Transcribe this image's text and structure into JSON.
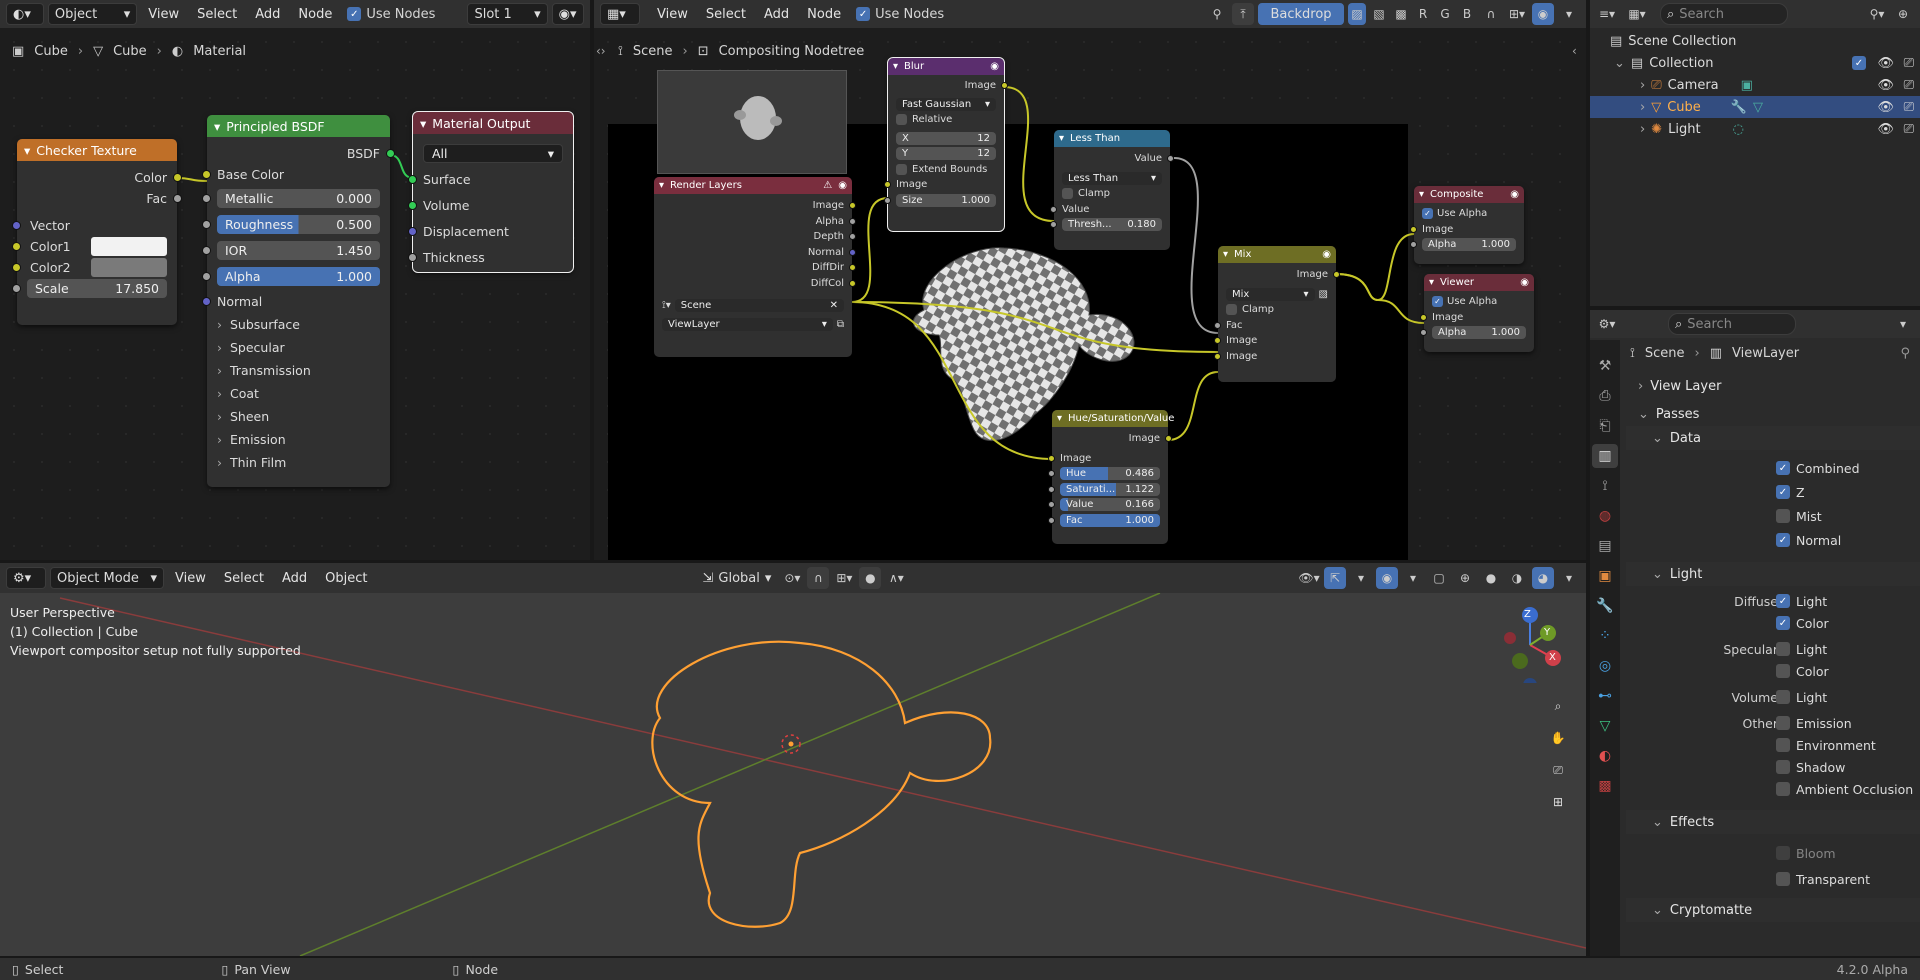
{
  "colors": {
    "accent": "#4772b3",
    "selection": "#ffa033",
    "header": "#303030",
    "bg": "#1d1d1d"
  },
  "shader_editor": {
    "header": {
      "mode": "Object",
      "menus": [
        "View",
        "Select",
        "Add",
        "Node"
      ],
      "use_nodes": "Use Nodes",
      "slot": "Slot 1"
    },
    "breadcrumb": [
      "Cube",
      "Cube",
      "Material"
    ],
    "checker": {
      "title": "Checker Texture",
      "out_color": "Color",
      "out_fac": "Fac",
      "vector": "Vector",
      "color1": "Color1",
      "color2": "Color2",
      "scale_label": "Scale",
      "scale_value": "17.850"
    },
    "bsdf": {
      "title": "Principled BSDF",
      "output": "BSDF",
      "base_color": "Base Color",
      "fields": [
        {
          "label": "Metallic",
          "value": "0.000"
        },
        {
          "label": "Roughness",
          "value": "0.500"
        },
        {
          "label": "IOR",
          "value": "1.450"
        },
        {
          "label": "Alpha",
          "value": "1.000"
        }
      ],
      "normal": "Normal",
      "panels": [
        "Subsurface",
        "Specular",
        "Transmission",
        "Coat",
        "Sheen",
        "Emission",
        "Thin Film"
      ]
    },
    "output": {
      "title": "Material Output",
      "target": "All",
      "inputs": [
        "Surface",
        "Volume",
        "Displacement",
        "Thickness"
      ]
    }
  },
  "compositor": {
    "header": {
      "menus": [
        "View",
        "Select",
        "Add",
        "Node"
      ],
      "use_nodes": "Use Nodes",
      "backdrop": "Backdrop",
      "channels": [
        "R",
        "G",
        "B"
      ]
    },
    "breadcrumb": [
      "Scene",
      "Compositing Nodetree"
    ],
    "render_layers": {
      "title": "Render Layers",
      "outputs": [
        "Image",
        "Alpha",
        "Depth",
        "Normal",
        "DiffDir",
        "DiffCol"
      ],
      "scene": "Scene",
      "view_layer": "ViewLayer"
    },
    "blur": {
      "title": "Blur",
      "output": "Image",
      "type": "Fast Gaussian",
      "relative": "Relative",
      "x_label": "X",
      "x_value": "12",
      "y_label": "Y",
      "y_value": "12",
      "extend": "Extend Bounds",
      "input": "Image",
      "size_label": "Size",
      "size_value": "1.000"
    },
    "less_than": {
      "title": "Less Than",
      "output": "Value",
      "op": "Less Than",
      "clamp": "Clamp",
      "input": "Value",
      "thresh_label": "Thresh...",
      "thresh_value": "0.180"
    },
    "mix": {
      "title": "Mix",
      "output": "Image",
      "blend": "Mix",
      "clamp": "Clamp",
      "inputs": [
        "Fac",
        "Image",
        "Image"
      ]
    },
    "hsv": {
      "title": "Hue/Saturation/Value",
      "output": "Image",
      "input": "Image",
      "fields": [
        {
          "label": "Hue",
          "value": "0.486"
        },
        {
          "label": "Saturati...",
          "value": "1.122"
        },
        {
          "label": "Value",
          "value": "0.166"
        },
        {
          "label": "Fac",
          "value": "1.000"
        }
      ]
    },
    "composite": {
      "title": "Composite",
      "use_alpha": "Use Alpha",
      "input": "Image",
      "alpha_label": "Alpha",
      "alpha_value": "1.000"
    },
    "viewer": {
      "title": "Viewer",
      "use_alpha": "Use Alpha",
      "input": "Image",
      "alpha_label": "Alpha",
      "alpha_value": "1.000"
    }
  },
  "viewport": {
    "header": {
      "mode": "Object Mode",
      "menus": [
        "View",
        "Select",
        "Add",
        "Object"
      ],
      "orientation": "Global"
    },
    "overlay": [
      "User Perspective",
      "(1) Collection | Cube",
      "Viewport compositor setup not fully supported"
    ],
    "gizmo": {
      "x": "X",
      "y": "Y",
      "z": "Z"
    }
  },
  "outliner": {
    "search_placeholder": "Search",
    "root": "Scene Collection",
    "collection": "Collection",
    "items": [
      {
        "label": "Camera"
      },
      {
        "label": "Cube"
      },
      {
        "label": "Light"
      }
    ]
  },
  "properties": {
    "search_placeholder": "Search",
    "breadcrumb": [
      "Scene",
      "ViewLayer"
    ],
    "sections": {
      "view_layer": "View Layer",
      "passes": "Passes",
      "data": "Data",
      "light": "Light",
      "effects": "Effects",
      "cryptomatte": "Cryptomatte"
    },
    "data_passes": [
      {
        "label": "Combined",
        "on": true
      },
      {
        "label": "Z",
        "on": true
      },
      {
        "label": "Mist",
        "on": false
      },
      {
        "label": "Normal",
        "on": true
      }
    ],
    "light": {
      "diffuse": "Diffuse",
      "specular": "Specular",
      "volume": "Volume",
      "other": "Other",
      "diffuse_opts": [
        "Light",
        "Color"
      ],
      "specular_opts": [
        "Light",
        "Color"
      ],
      "volume_opts": [
        "Light"
      ],
      "other_opts": [
        "Emission",
        "Environment",
        "Shadow",
        "Ambient Occlusion"
      ]
    },
    "effects": {
      "bloom": "Bloom",
      "transparent": "Transparent"
    }
  },
  "statusbar": {
    "select": "Select",
    "pan": "Pan View",
    "node": "Node",
    "version": "4.2.0 Alpha"
  }
}
